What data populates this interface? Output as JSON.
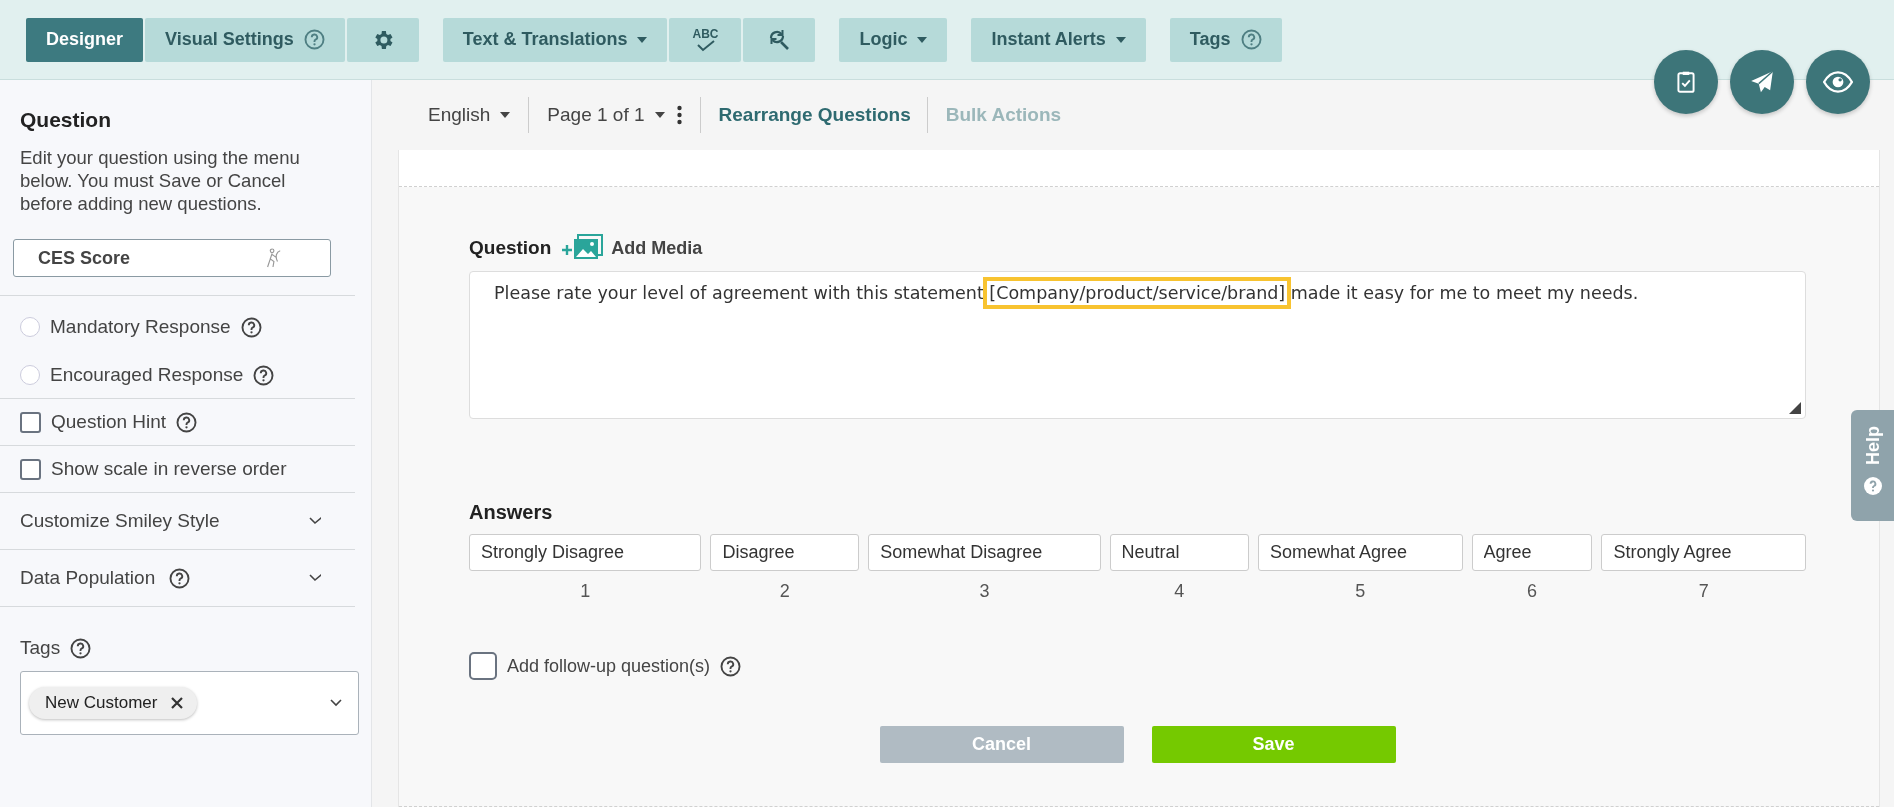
{
  "top_bar": {
    "groups": [
      {
        "items": [
          {
            "kind": "label",
            "label": "Designer",
            "selected": true
          },
          {
            "kind": "label",
            "label": "Visual Settings",
            "selected": false,
            "help": true
          },
          {
            "kind": "settings",
            "selected": false
          }
        ]
      },
      {
        "items": [
          {
            "kind": "label",
            "label": "Text & Translations",
            "selected": false,
            "dropdown": true
          },
          {
            "kind": "spellcheck",
            "label": "ABC",
            "selected": false
          },
          {
            "kind": "replace",
            "selected": false
          }
        ]
      },
      {
        "items": [
          {
            "kind": "label",
            "label": "Logic",
            "selected": false,
            "dropdown": true
          }
        ]
      },
      {
        "items": [
          {
            "kind": "label",
            "label": "Instant Alerts",
            "selected": false,
            "dropdown": true
          }
        ]
      },
      {
        "items": [
          {
            "kind": "label",
            "label": "Tags",
            "selected": false,
            "help": true
          }
        ]
      }
    ]
  },
  "floating_actions": [
    {
      "kind": "checklist"
    },
    {
      "kind": "send"
    },
    {
      "kind": "preview"
    }
  ],
  "sidebar": {
    "title": "Question",
    "description": "Edit your question using the menu below. You must Save or Cancel before adding new questions.",
    "question_type": "CES Score",
    "radios": [
      {
        "label": "Mandatory Response",
        "checked": false
      },
      {
        "label": "Encouraged Response",
        "checked": false
      }
    ],
    "checkboxes": [
      {
        "label": "Question Hint",
        "checked": false,
        "help": true
      },
      {
        "label": "Show scale in reverse order",
        "checked": false
      }
    ],
    "sections": [
      {
        "label": "Customize Smiley Style",
        "expanded": false
      },
      {
        "label": "Data Population",
        "expanded": false,
        "help": true
      }
    ],
    "tags_label": "Tags",
    "tags": [
      "New Customer"
    ]
  },
  "toolbar": {
    "language": "English",
    "page": "Page 1 of 1",
    "actions": [
      {
        "label": "Rearrange Questions",
        "disabled": false
      },
      {
        "label": "Bulk Actions",
        "disabled": true
      }
    ]
  },
  "editor": {
    "question_label": "Question",
    "add_media": "Add Media",
    "question_text": [
      {
        "text": "Please rate your level of agreement with this statement ",
        "highlighted": false
      },
      {
        "text": "[Company/product/service/brand]",
        "highlighted": true
      },
      {
        "text": " made it easy for me to meet my needs.",
        "highlighted": false
      }
    ],
    "answers_label": "Answers",
    "answers": [
      {
        "value": "Strongly Disagree",
        "number": "1"
      },
      {
        "value": "Disagree",
        "number": "2"
      },
      {
        "value": "Somewhat Disagree",
        "number": "3"
      },
      {
        "value": "Neutral",
        "number": "4"
      },
      {
        "value": "Somewhat Agree",
        "number": "5"
      },
      {
        "value": "Agree",
        "number": "6"
      },
      {
        "value": "Strongly Agree",
        "number": "7"
      }
    ],
    "follow_up": {
      "label": "Add follow-up question(s)",
      "checked": false
    },
    "buttons": [
      {
        "label": "Cancel",
        "kind": "secondary"
      },
      {
        "label": "Save",
        "kind": "primary"
      }
    ]
  },
  "help_tab": "Help"
}
